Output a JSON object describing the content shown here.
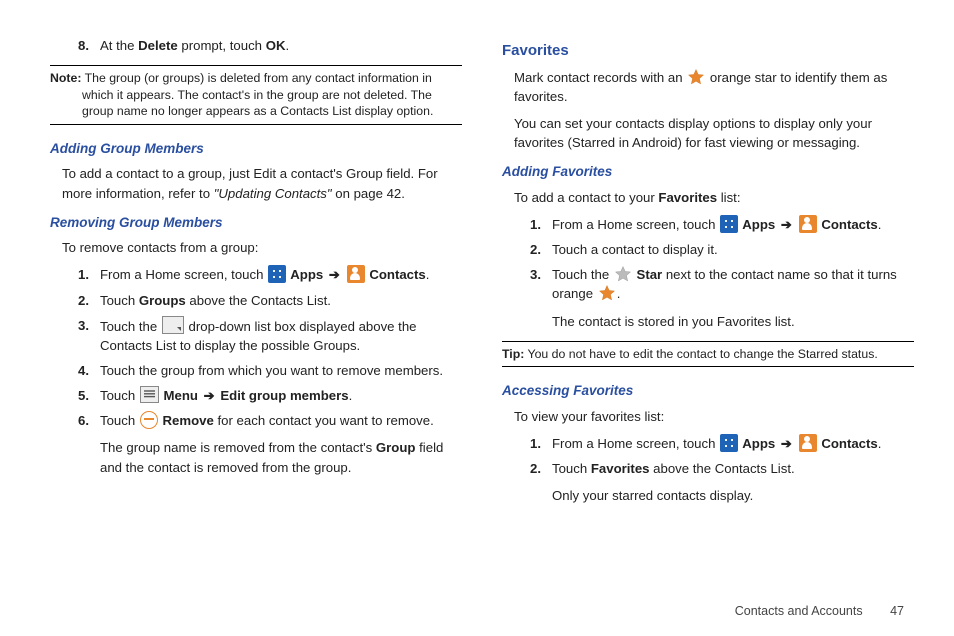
{
  "left": {
    "step8": {
      "num": "8.",
      "pre": "At the ",
      "bold1": "Delete",
      "mid": " prompt, touch ",
      "bold2": "OK",
      "post": "."
    },
    "note": {
      "label": "Note:",
      "text": " The group (or groups) is deleted from any contact information in which it appears. The contact's in the group are not deleted. The group name no longer appears as a Contacts List display option."
    },
    "h_add": "Adding Group Members",
    "add_para_pre": "To add a contact to a group, just Edit a contact's Group field. For more information, refer to ",
    "add_para_ital": "\"Updating Contacts\"",
    "add_para_post": "  on page 42.",
    "h_rem": "Removing Group Members",
    "rem_para": "To remove contacts from a group:",
    "s1": {
      "num": "1.",
      "pre": "From a Home screen, touch ",
      "apps": " Apps",
      "arrow": " ➔ ",
      "contacts": " Contacts",
      "post": "."
    },
    "s2": {
      "num": "2.",
      "pre": "Touch ",
      "bold": "Groups",
      "post": " above the Contacts List."
    },
    "s3": {
      "num": "3.",
      "pre": "Touch the ",
      "post": " drop-down list box displayed above the Contacts List to display the possible Groups."
    },
    "s4": {
      "num": "4.",
      "text": "Touch the group from which you want to remove members."
    },
    "s5": {
      "num": "5.",
      "pre": "Touch ",
      "menu": " Menu",
      "arrow": " ➔ ",
      "edit": "Edit group members",
      "post": "."
    },
    "s6": {
      "num": "6.",
      "pre": "Touch ",
      "remove": " Remove",
      "post": " for each contact you want to remove.",
      "cont_pre": "The group name is removed from the contact's ",
      "cont_bold": "Group",
      "cont_post": " field and the contact is removed from the group."
    }
  },
  "right": {
    "h_fav": "Favorites",
    "fav_p1_pre": "Mark contact records with an ",
    "fav_p1_post": " orange star to identify them as favorites.",
    "fav_p2": "You can set your contacts display options to display only your favorites (Starred in Android) for fast viewing or messaging.",
    "h_addfav": "Adding Favorites",
    "addfav_intro_pre": "To add a contact to your ",
    "addfav_intro_bold": "Favorites",
    "addfav_intro_post": " list:",
    "a1": {
      "num": "1.",
      "pre": "From a Home screen, touch ",
      "apps": " Apps",
      "arrow": " ➔ ",
      "contacts": " Contacts",
      "post": "."
    },
    "a2": {
      "num": "2.",
      "text": "Touch a contact to display it."
    },
    "a3": {
      "num": "3.",
      "pre": "Touch the ",
      "star": " Star",
      "mid": " next to the contact name so that it turns orange ",
      "post": ".",
      "cont": "The contact is stored in you Favorites list."
    },
    "tip": {
      "label": "Tip:",
      "text": " You do not have to edit the contact to change the Starred status."
    },
    "h_acc": "Accessing Favorites",
    "acc_intro": "To view your favorites list:",
    "c1": {
      "num": "1.",
      "pre": "From a Home screen, touch ",
      "apps": " Apps",
      "arrow": " ➔ ",
      "contacts": " Contacts",
      "post": "."
    },
    "c2": {
      "num": "2.",
      "pre": "Touch ",
      "bold": "Favorites",
      "post": " above the Contacts List.",
      "cont": "Only your starred contacts display."
    }
  },
  "footer": {
    "section": "Contacts and Accounts",
    "page": "47"
  }
}
